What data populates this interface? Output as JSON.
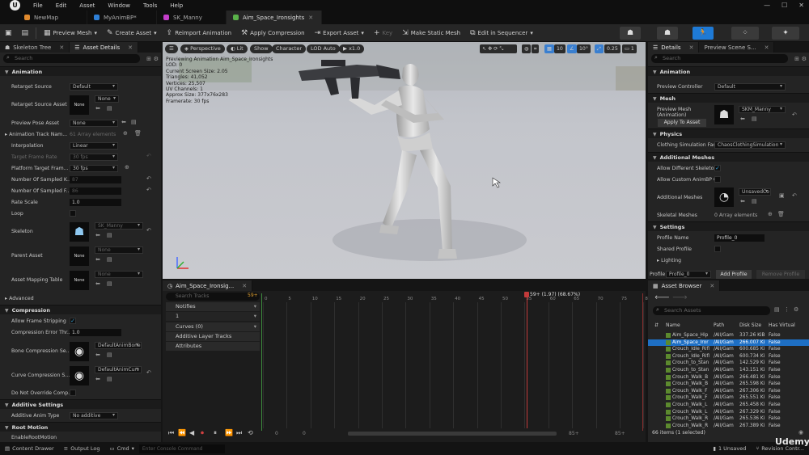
{
  "menu": {
    "items": [
      "File",
      "Edit",
      "Asset",
      "Window",
      "Tools",
      "Help"
    ]
  },
  "tabs": [
    {
      "label": "NewMap",
      "color": "#e08a2e"
    },
    {
      "label": "MyAnimBP*",
      "color": "#2e7fd6"
    },
    {
      "label": "SK_Manny",
      "color": "#c33ec9"
    },
    {
      "label": "Aim_Space_Ironsights",
      "color": "#5ab24a"
    }
  ],
  "toolbar": {
    "preview_mesh": "Preview Mesh",
    "create_asset": "Create Asset",
    "reimport": "Reimport Animation",
    "apply_compression": "Apply Compression",
    "export_asset": "Export Asset",
    "key": "Key",
    "make_static_mesh": "Make Static Mesh",
    "edit_in_sequencer": "Edit in Sequencer"
  },
  "left": {
    "tabs": [
      "Skeleton Tree",
      "Asset Details"
    ],
    "search_placeholder": "Search",
    "sections": {
      "animation": "Animation",
      "advanced": "Advanced",
      "compression": "Compression",
      "additive": "Additive Settings",
      "root_motion": "Root Motion"
    },
    "props": {
      "retarget_source": "Retarget Source",
      "retarget_source_val": "Default",
      "retarget_source_asset": "Retarget Source Asset",
      "none": "None",
      "preview_pose_asset": "Preview Pose Asset",
      "anim_track_names": "Animation Track Nam...",
      "anim_track_val": "61 Array elements",
      "interpolation": "Interpolation",
      "interpolation_val": "Linear",
      "target_frame_rate": "Target Frame Rate",
      "target_frame_rate_val": "30 fps",
      "platform_target": "Platform Target Fram...",
      "platform_target_val": "30 fps",
      "num_sampled_keys": "Number Of Sampled K...",
      "num_sampled_keys_val": "87",
      "num_sampled_frames": "Number Of Sampled F...",
      "num_sampled_frames_val": "86",
      "rate_scale": "Rate Scale",
      "rate_scale_val": "1.0",
      "loop": "Loop",
      "skeleton": "Skeleton",
      "skeleton_val": "SK_Manny",
      "parent_asset": "Parent Asset",
      "asset_mapping": "Asset Mapping Table",
      "allow_frame_strip": "Allow Frame Stripping",
      "compression_error": "Compression Error Thr...",
      "compression_error_val": "1.0",
      "bone_compression": "Bone Compression Se...",
      "bone_compression_val": "DefaultAnimBone",
      "curve_compression": "Curve Compression S...",
      "curve_compression_val": "DefaultAnimCurv",
      "do_not_override": "Do Not Override Comp...",
      "additive_anim_type": "Additive Anim Type",
      "additive_anim_type_val": "No additive",
      "enable_root_motion": "EnableRootMotion"
    }
  },
  "viewport": {
    "perspective": "Perspective",
    "lit": "Lit",
    "show": "Show",
    "character": "Character",
    "lod": "LOD Auto",
    "speed": "x1.0",
    "info": [
      "Previewing Animation Aim_Space_Ironsights",
      "LOD: 0",
      "Current Screen Size: 2.05",
      "Triangles: 41,052",
      "Vertices: 25,507",
      "UV Channels: 1",
      "Approx Size: 377x76x283",
      "Framerate: 30 fps"
    ],
    "grid_val": "10",
    "angle_val": "10°",
    "scale_val": "0.25",
    "cam_val": "1"
  },
  "sequencer": {
    "tab": "Aim_Space_Ironsig...",
    "search_placeholder": "Search Tracks",
    "frame_badge": "59+",
    "notifies": "Notifies",
    "notify_count": "1",
    "curves": "Curves",
    "curves_count": "(0)",
    "additive_layer": "Additive Layer Tracks",
    "attributes": "Attributes",
    "ticks": [
      "0",
      "5",
      "10",
      "15",
      "20",
      "25",
      "30",
      "35",
      "40",
      "45",
      "50",
      "55",
      "60",
      "65",
      "70",
      "75",
      "80",
      "85"
    ],
    "playhead": "59+ (1.97) (68.67%)",
    "range_start": "0",
    "range_start2": "0",
    "range_end": "85+",
    "range_end2": "85+"
  },
  "details": {
    "tabs": [
      "Details",
      "Preview Scene S..."
    ],
    "search_placeholder": "Search",
    "sections": {
      "animation": "Animation",
      "mesh": "Mesh",
      "physics": "Physics",
      "additional_meshes": "Additional Meshes",
      "settings": "Settings",
      "lighting": "Lighting"
    },
    "preview_controller": "Preview Controller",
    "preview_controller_val": "Default",
    "preview_mesh": "Preview Mesh (Animation)",
    "preview_mesh_val": "SKM_Manny",
    "apply_to_asset": "Apply To Asset",
    "clothing_sim": "Clothing Simulation Fact",
    "clothing_sim_val": "ChaosClothingSimulation",
    "allow_diff_skeleton": "Allow Different Skeleton",
    "allow_custom_animbp": "Allow Custom AnimBP C",
    "additional_meshes": "Additional Meshes",
    "additional_meshes_val": "UnsavedCo",
    "skeletal_meshes": "Skeletal Meshes",
    "skeletal_meshes_val": "0 Array elements",
    "profile_name": "Profile Name",
    "profile_name_val": "Profile_0",
    "shared_profile": "Shared Profile",
    "profile": "Profile",
    "profile_val": "Profile_0",
    "add_profile": "Add Profile",
    "remove_profile": "Remove Profile"
  },
  "asset_browser": {
    "tab": "Asset Browser",
    "search_placeholder": "Search Assets",
    "columns": [
      "Name",
      "Path",
      "Disk Size",
      "Has Virtual"
    ],
    "rows": [
      [
        "Aim_Space_Hip",
        "/All/Gam",
        "337.26 KiB",
        "False"
      ],
      [
        "Aim_Space_Iror",
        "/All/Gam",
        "266.007 Ki",
        "False"
      ],
      [
        "Crouch_Idle_Rifl",
        "/All/Gam",
        "600.685 Ki",
        "False"
      ],
      [
        "Crouch_Idle_Rifl",
        "/All/Gam",
        "600.734 Ki",
        "False"
      ],
      [
        "Crouch_to_Stan",
        "/All/Gam",
        "142.529 Ki",
        "False"
      ],
      [
        "Crouch_to_Stan",
        "/All/Gam",
        "143.151 Ki",
        "False"
      ],
      [
        "Crouch_Walk_B",
        "/All/Gam",
        "266.481 Ki",
        "False"
      ],
      [
        "Crouch_Walk_B",
        "/All/Gam",
        "265.598 Ki",
        "False"
      ],
      [
        "Crouch_Walk_F",
        "/All/Gam",
        "267.306 Ki",
        "False"
      ],
      [
        "Crouch_Walk_F",
        "/All/Gam",
        "265.551 Ki",
        "False"
      ],
      [
        "Crouch_Walk_L",
        "/All/Gam",
        "265.458 Ki",
        "False"
      ],
      [
        "Crouch_Walk_L",
        "/All/Gam",
        "267.329 Ki",
        "False"
      ],
      [
        "Crouch_Walk_R",
        "/All/Gam",
        "265.536 Ki",
        "False"
      ],
      [
        "Crouch_Walk_R",
        "/All/Gam",
        "267.389 Ki",
        "False"
      ]
    ],
    "footer": "66 items (1 selected)"
  },
  "status": {
    "content_drawer": "Content Drawer",
    "output_log": "Output Log",
    "cmd": "Cmd",
    "console_placeholder": "Enter Console Command",
    "unsaved": "1 Unsaved",
    "revision": "Revision Contr...",
    "watermark": "Udemy"
  }
}
